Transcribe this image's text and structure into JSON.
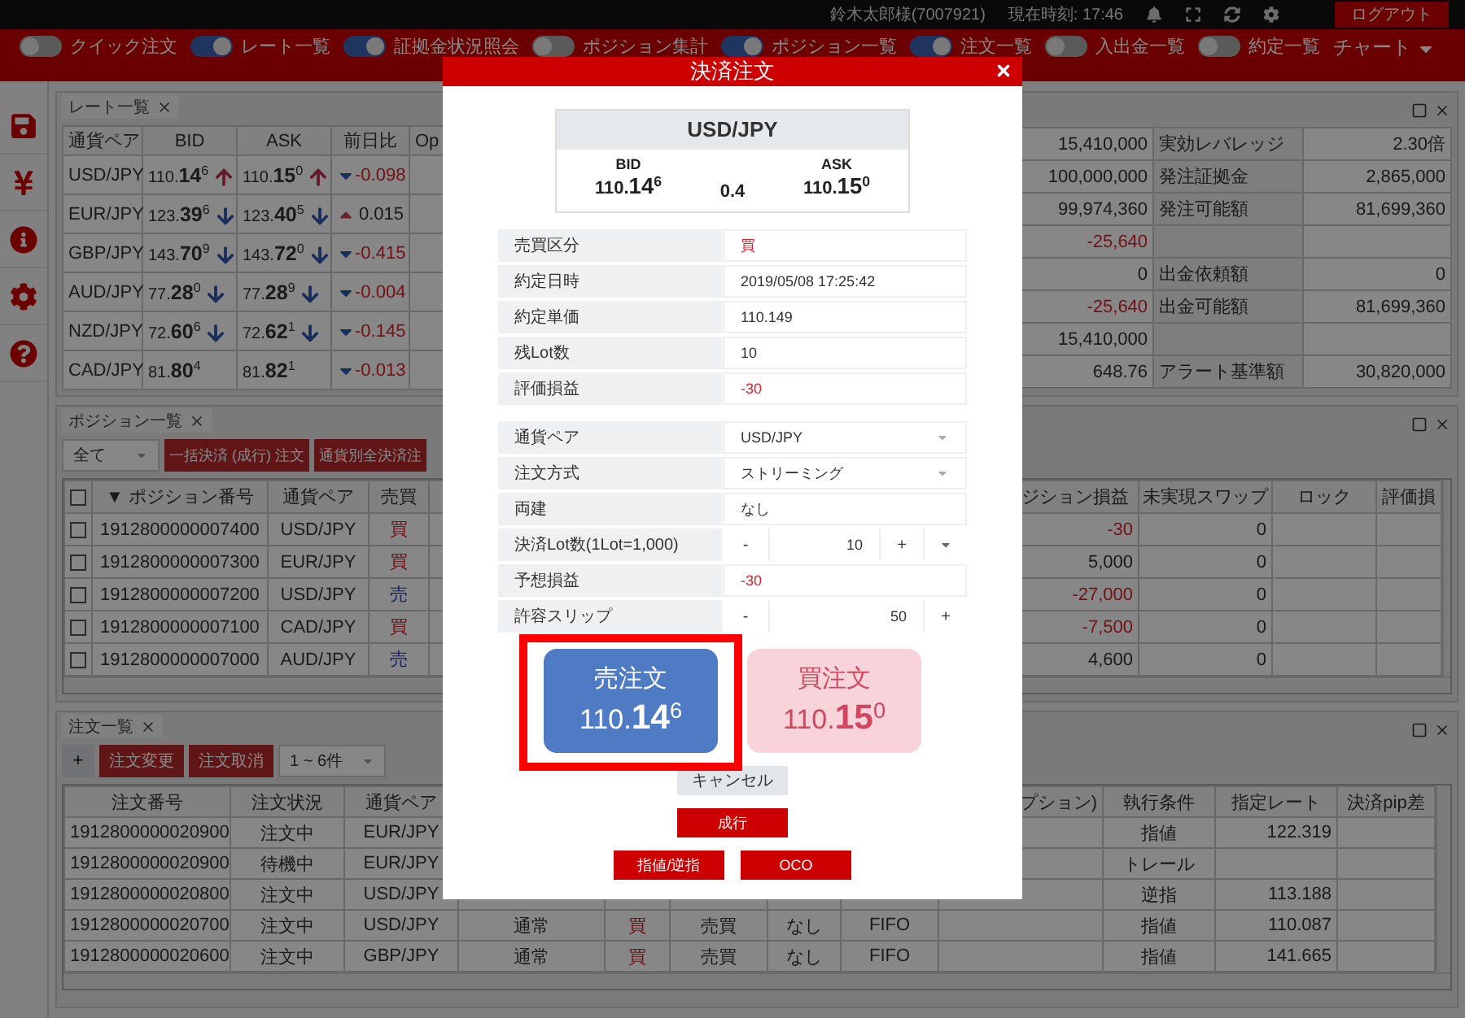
{
  "top_bar": {
    "user": "鈴木太郎様(7007921)",
    "time": "現在時刻: 17:46",
    "logout": "ログアウト"
  },
  "toolbar": {
    "toggles": [
      {
        "label": "クイック注文",
        "on": false
      },
      {
        "label": "レート一覧",
        "on": true
      },
      {
        "label": "証拠金状況照会",
        "on": true
      },
      {
        "label": "ポジション集計",
        "on": false
      },
      {
        "label": "ポジション一覧",
        "on": true
      },
      {
        "label": "注文一覧",
        "on": true
      },
      {
        "label": "入出金一覧",
        "on": false
      },
      {
        "label": "約定一覧",
        "on": false
      }
    ],
    "chart_menu": "チャート"
  },
  "sidebar": {
    "items": [
      {
        "kind": "save"
      },
      {
        "kind": "yen"
      },
      {
        "kind": "info"
      },
      {
        "kind": "settings"
      },
      {
        "kind": "help"
      }
    ]
  },
  "rate_panel": {
    "tab": "レート一覧",
    "columns": [
      "通貨ペア",
      "BID",
      "ASK",
      "前日比",
      "Op"
    ],
    "rows": [
      {
        "pair": "USD/JPY",
        "bid": {
          "base": "110.",
          "pips": "14",
          "frac": "6",
          "rising": true
        },
        "ask": {
          "base": "110.",
          "pips": "15",
          "frac": "0",
          "rising": true
        },
        "change": {
          "value": "-0.098",
          "rising": false,
          "negative": true
        }
      },
      {
        "pair": "EUR/JPY",
        "bid": {
          "base": "123.",
          "pips": "39",
          "frac": "6",
          "rising": false
        },
        "ask": {
          "base": "123.",
          "pips": "40",
          "frac": "5",
          "rising": false
        },
        "change": {
          "value": "0.015",
          "rising": true,
          "negative": false
        }
      },
      {
        "pair": "GBP/JPY",
        "bid": {
          "base": "143.",
          "pips": "70",
          "frac": "9",
          "rising": false
        },
        "ask": {
          "base": "143.",
          "pips": "72",
          "frac": "0",
          "rising": false
        },
        "change": {
          "value": "-0.415",
          "rising": false,
          "negative": true
        }
      },
      {
        "pair": "AUD/JPY",
        "bid": {
          "base": "77.",
          "pips": "28",
          "frac": "0",
          "rising": false
        },
        "ask": {
          "base": "77.",
          "pips": "28",
          "frac": "9",
          "rising": false
        },
        "change": {
          "value": "-0.004",
          "rising": false,
          "negative": true
        }
      },
      {
        "pair": "NZD/JPY",
        "bid": {
          "base": "72.",
          "pips": "60",
          "frac": "6",
          "rising": false
        },
        "ask": {
          "base": "72.",
          "pips": "62",
          "frac": "1",
          "rising": false
        },
        "change": {
          "value": "-0.145",
          "rising": false,
          "negative": true
        }
      },
      {
        "pair": "CAD/JPY",
        "bid": {
          "base": "81.",
          "pips": "80",
          "frac": "4"
        },
        "ask": {
          "base": "81.",
          "pips": "82",
          "frac": "1"
        },
        "change": {
          "value": "-0.013",
          "rising": false,
          "negative": true
        }
      }
    ]
  },
  "account_panel": {
    "rows": [
      {
        "amount": {
          "value": "15,410,000",
          "negative": false
        },
        "item": {
          "label": "実効レバレッジ",
          "value": "2.30倍"
        }
      },
      {
        "amount": {
          "value": "100,000,000",
          "negative": false
        },
        "item": {
          "label": "発注証拠金",
          "value": "2,865,000"
        }
      },
      {
        "amount": {
          "value": "99,974,360",
          "negative": false
        },
        "item": {
          "label": "発注可能額",
          "value": "81,699,360"
        }
      },
      {
        "amount": {
          "value": "-25,640",
          "negative": true
        }
      },
      {
        "amount": {
          "value": "0",
          "negative": false
        },
        "item": {
          "label": "出金依頼額",
          "value": "0"
        }
      },
      {
        "amount": {
          "value": "-25,640",
          "negative": true
        },
        "item": {
          "label": "出金可能額",
          "value": "81,699,360"
        }
      },
      {
        "amount": {
          "value": "15,410,000",
          "negative": false
        }
      },
      {
        "amount": {
          "value": "648.76",
          "negative": false
        },
        "item": {
          "label": "アラート基準額",
          "value": "30,820,000"
        }
      }
    ]
  },
  "position_panel": {
    "tab": "ポジション一覧",
    "filter": "全て",
    "buttons": [
      "一括決済 (成行) 注文",
      "通貨別全決済注"
    ],
    "all_checked": false,
    "columns_left": [
      "▼ ポジション番号",
      "通貨ペア",
      "売買"
    ],
    "columns_right": [
      "ジション損益",
      "未実現スワップ",
      "ロック",
      "評価損"
    ],
    "rows": [
      {
        "checked": false,
        "number": "1912800000007400",
        "pair": "USD/JPY",
        "side": "買",
        "buy": true,
        "pnl": "-30",
        "negative": true,
        "swap": "0"
      },
      {
        "checked": false,
        "number": "1912800000007300",
        "pair": "EUR/JPY",
        "side": "買",
        "buy": true,
        "pnl": "5,000",
        "negative": false,
        "swap": "0"
      },
      {
        "checked": false,
        "number": "1912800000007200",
        "pair": "USD/JPY",
        "side": "売",
        "buy": false,
        "pnl": "-27,000",
        "negative": true,
        "swap": "0"
      },
      {
        "checked": false,
        "number": "1912800000007100",
        "pair": "CAD/JPY",
        "side": "買",
        "buy": true,
        "pnl": "-7,500",
        "negative": true,
        "swap": "0"
      },
      {
        "checked": false,
        "number": "1912800000007000",
        "pair": "AUD/JPY",
        "side": "売",
        "buy": false,
        "pnl": "4,600",
        "negative": false,
        "swap": "0"
      }
    ]
  },
  "order_panel": {
    "tab": "注文一覧",
    "add": "+",
    "buttons": [
      "注文変更",
      "注文取消"
    ],
    "range": "1 ~ 6件",
    "columns_left": [
      "注文番号",
      "注文状況",
      "通貨ペア"
    ],
    "columns_right": [
      "プション)",
      "執行条件",
      "指定レート",
      "決済pip差"
    ],
    "rows": [
      {
        "number": "1912800000020900",
        "status": "注文中",
        "pair": "EUR/JPY",
        "condition": "指値",
        "rate": "122.319"
      },
      {
        "number": "1912800000020900",
        "status": "待機中",
        "pair": "EUR/JPY",
        "condition": "トレール"
      },
      {
        "number": "1912800000020800",
        "status": "注文中",
        "pair": "USD/JPY",
        "condition": "逆指",
        "rate": "113.188"
      },
      {
        "number": "1912800000020700",
        "status": "注文中",
        "pair": "USD/JPY",
        "type": "通常",
        "side": "買",
        "buy": true,
        "trade": "売買",
        "hedge": "なし",
        "rule": "FIFO",
        "condition": "指値",
        "rate": "110.087"
      },
      {
        "number": "1912800000020600",
        "status": "注文中",
        "pair": "GBP/JPY",
        "type": "通常",
        "side": "買",
        "buy": true,
        "trade": "売買",
        "hedge": "なし",
        "rule": "FIFO",
        "condition": "指値",
        "rate": "141.665"
      }
    ]
  },
  "modal": {
    "title": "決済注文",
    "quote": {
      "pair": "USD/JPY",
      "bid_label": "BID",
      "ask_label": "ASK",
      "bid": {
        "base": "110.",
        "pips": "14",
        "frac": "6"
      },
      "spread": "0.4",
      "ask": {
        "base": "110.",
        "pips": "15",
        "frac": "0"
      }
    },
    "info_rows": [
      {
        "label": "売買区分",
        "value": "買",
        "negative": true
      },
      {
        "label": "約定日時",
        "value": "2019/05/08 17:25:42",
        "negative": false
      },
      {
        "label": "約定単価",
        "value": "110.149",
        "negative": false
      },
      {
        "label": "残Lot数",
        "value": "10",
        "negative": false
      },
      {
        "label": "評価損益",
        "value": "-30",
        "negative": true
      }
    ],
    "form_rows": [
      {
        "kind": "select",
        "label": "通貨ペア",
        "value": "USD/JPY"
      },
      {
        "kind": "select",
        "label": "注文方式",
        "value": "ストリーミング"
      },
      {
        "kind": "text",
        "label": "両建",
        "value": "なし",
        "negative": false
      },
      {
        "kind": "stepper",
        "label": "決済Lot数(1Lot=1,000)",
        "minus": "-",
        "value": "10",
        "plus": "+",
        "menu": true
      },
      {
        "kind": "text",
        "label": "予想損益",
        "value": "-30",
        "negative": true
      },
      {
        "kind": "stepper",
        "label": "許容スリップ",
        "minus": "-",
        "value": "50",
        "plus": "+",
        "menu": false
      }
    ],
    "order_buttons": [
      {
        "label": "売注文",
        "sell": true,
        "price": {
          "base": "110.",
          "pips": "14",
          "frac": "6"
        },
        "disabled": false,
        "highlighted": true
      },
      {
        "label": "買注文",
        "sell": false,
        "price": {
          "base": "110.",
          "pips": "15",
          "frac": "0"
        },
        "disabled": true,
        "highlighted": false
      }
    ],
    "cancel": "キャンセル",
    "market": "成行",
    "limit_buttons": [
      "指値/逆指",
      "OCO"
    ]
  }
}
